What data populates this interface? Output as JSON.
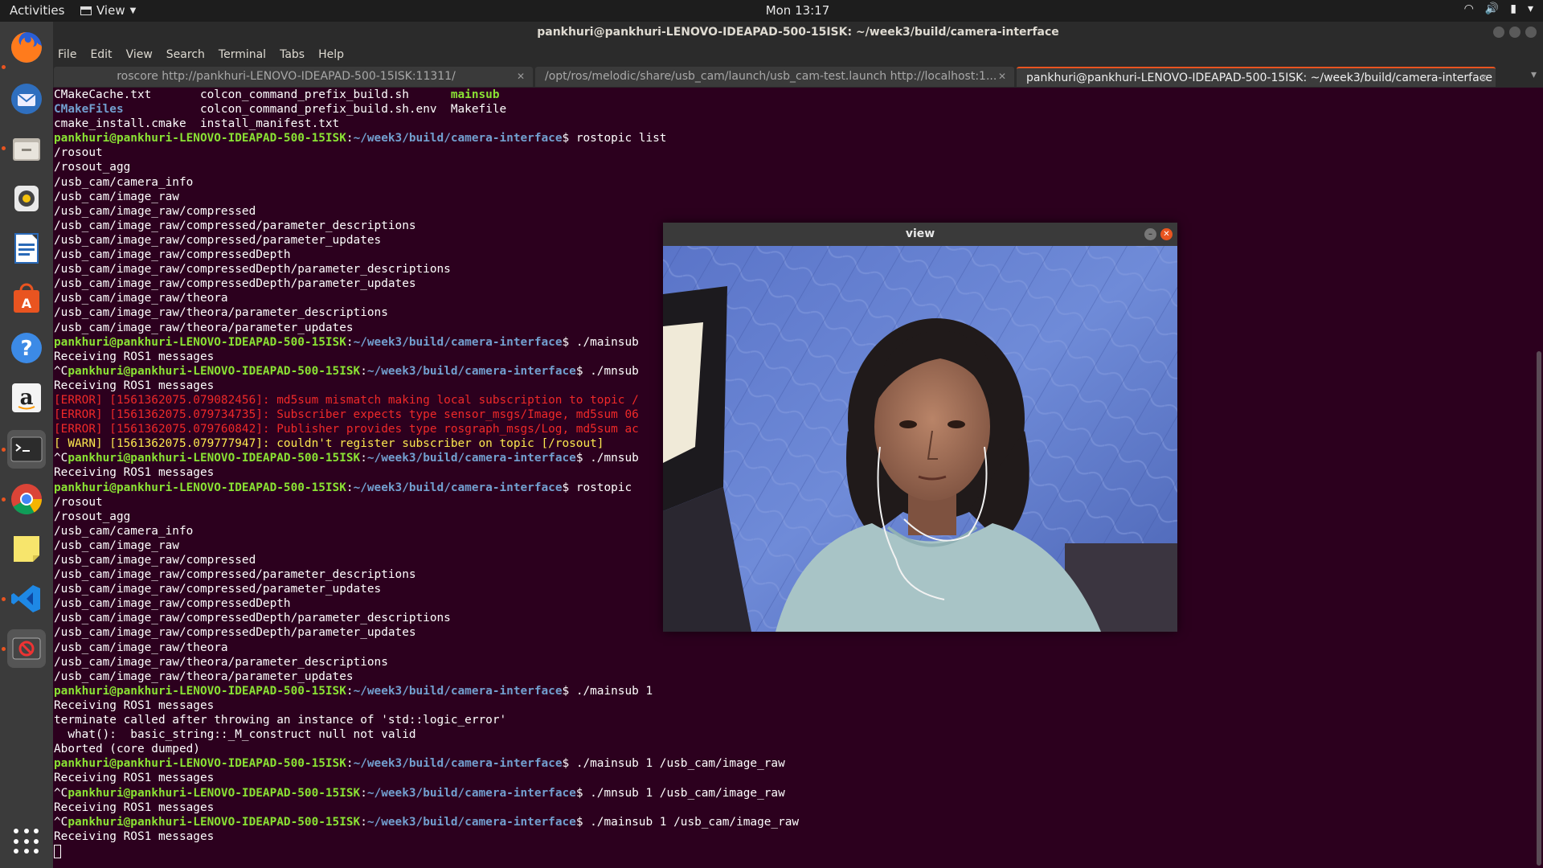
{
  "topbar": {
    "activities": "Activities",
    "view_menu": "View",
    "clock": "Mon 13:17"
  },
  "dock": {
    "items": [
      {
        "name": "firefox-icon",
        "active": true
      },
      {
        "name": "thunderbird-icon",
        "active": false
      },
      {
        "name": "files-icon",
        "active": true
      },
      {
        "name": "rhythmbox-icon",
        "active": false
      },
      {
        "name": "libreoffice-writer-icon",
        "active": false
      },
      {
        "name": "software-center-icon",
        "active": false
      },
      {
        "name": "help-icon",
        "active": false
      },
      {
        "name": "amazon-icon",
        "active": false
      },
      {
        "name": "terminal-icon",
        "active": true
      },
      {
        "name": "chrome-icon",
        "active": true
      },
      {
        "name": "sticky-notes-icon",
        "active": false
      },
      {
        "name": "vscode-icon",
        "active": true
      },
      {
        "name": "blocked-app-icon",
        "active": true
      }
    ],
    "show_apps": "show-applications-icon"
  },
  "terminal": {
    "title": "pankhuri@pankhuri-LENOVO-IDEAPAD-500-15ISK: ~/week3/build/camera-interface",
    "menu": [
      "File",
      "Edit",
      "View",
      "Search",
      "Terminal",
      "Tabs",
      "Help"
    ],
    "tabs": [
      {
        "label": "roscore http://pankhuri-LENOVO-IDEAPAD-500-15ISK:11311/",
        "active": false
      },
      {
        "label": "/opt/ros/melodic/share/usb_cam/launch/usb_cam-test.launch http://localhost:1...",
        "active": false
      },
      {
        "label": "pankhuri@pankhuri-LENOVO-IDEAPAD-500-15ISK: ~/week3/build/camera-interface",
        "active": true
      }
    ],
    "prompt_user": "pankhuri@pankhuri-LENOVO-IDEAPAD-500-15ISK",
    "prompt_path": "~/week3/build/camera-interface",
    "lines": [
      {
        "t": "ls",
        "parts": [
          [
            "CMakeCache.txt       ",
            ""
          ],
          [
            "colcon_command_prefix_build.sh      ",
            ""
          ],
          [
            "mainsub",
            "exec"
          ]
        ]
      },
      {
        "t": "ls",
        "parts": [
          [
            "CMakeFiles",
            "dir"
          ],
          [
            "           colcon_command_prefix_build.sh.env  Makefile",
            ""
          ]
        ]
      },
      {
        "t": "out",
        "text": "cmake_install.cmake  install_manifest.txt"
      },
      {
        "t": "prompt",
        "pre": "",
        "cmd": " rostopic list"
      },
      {
        "t": "out",
        "text": "/rosout"
      },
      {
        "t": "out",
        "text": "/rosout_agg"
      },
      {
        "t": "out",
        "text": "/usb_cam/camera_info"
      },
      {
        "t": "out",
        "text": "/usb_cam/image_raw"
      },
      {
        "t": "out",
        "text": "/usb_cam/image_raw/compressed"
      },
      {
        "t": "out",
        "text": "/usb_cam/image_raw/compressed/parameter_descriptions"
      },
      {
        "t": "out",
        "text": "/usb_cam/image_raw/compressed/parameter_updates"
      },
      {
        "t": "out",
        "text": "/usb_cam/image_raw/compressedDepth"
      },
      {
        "t": "out",
        "text": "/usb_cam/image_raw/compressedDepth/parameter_descriptions"
      },
      {
        "t": "out",
        "text": "/usb_cam/image_raw/compressedDepth/parameter_updates"
      },
      {
        "t": "out",
        "text": "/usb_cam/image_raw/theora"
      },
      {
        "t": "out",
        "text": "/usb_cam/image_raw/theora/parameter_descriptions"
      },
      {
        "t": "out",
        "text": "/usb_cam/image_raw/theora/parameter_updates"
      },
      {
        "t": "prompt",
        "pre": "",
        "cmd": " ./mainsub"
      },
      {
        "t": "out",
        "text": "Receiving ROS1 messages"
      },
      {
        "t": "prompt",
        "pre": "^C",
        "cmd": " ./mnsub"
      },
      {
        "t": "out",
        "text": "Receiving ROS1 messages"
      },
      {
        "t": "err",
        "text": "[ERROR] [1561362075.079082456]: md5sum mismatch making local subscription to topic /"
      },
      {
        "t": "err",
        "text": "[ERROR] [1561362075.079734735]: Subscriber expects type sensor_msgs/Image, md5sum 06"
      },
      {
        "t": "err",
        "text": "[ERROR] [1561362075.079760842]: Publisher provides type rosgraph_msgs/Log, md5sum ac"
      },
      {
        "t": "warn",
        "text": "[ WARN] [1561362075.079777947]: couldn't register subscriber on topic [/rosout]"
      },
      {
        "t": "prompt",
        "pre": "^C",
        "cmd": " ./mnsub"
      },
      {
        "t": "out",
        "text": "Receiving ROS1 messages"
      },
      {
        "t": "prompt",
        "pre": "",
        "cmd": " rostopic"
      },
      {
        "t": "out",
        "text": "/rosout"
      },
      {
        "t": "out",
        "text": "/rosout_agg"
      },
      {
        "t": "out",
        "text": "/usb_cam/camera_info"
      },
      {
        "t": "out",
        "text": "/usb_cam/image_raw"
      },
      {
        "t": "out",
        "text": "/usb_cam/image_raw/compressed"
      },
      {
        "t": "out",
        "text": "/usb_cam/image_raw/compressed/parameter_descriptions"
      },
      {
        "t": "out",
        "text": "/usb_cam/image_raw/compressed/parameter_updates"
      },
      {
        "t": "out",
        "text": "/usb_cam/image_raw/compressedDepth"
      },
      {
        "t": "out",
        "text": "/usb_cam/image_raw/compressedDepth/parameter_descriptions"
      },
      {
        "t": "out",
        "text": "/usb_cam/image_raw/compressedDepth/parameter_updates"
      },
      {
        "t": "out",
        "text": "/usb_cam/image_raw/theora"
      },
      {
        "t": "out",
        "text": "/usb_cam/image_raw/theora/parameter_descriptions"
      },
      {
        "t": "out",
        "text": "/usb_cam/image_raw/theora/parameter_updates"
      },
      {
        "t": "prompt",
        "pre": "",
        "cmd": " ./mainsub 1"
      },
      {
        "t": "out",
        "text": "Receiving ROS1 messages"
      },
      {
        "t": "out",
        "text": "terminate called after throwing an instance of 'std::logic_error'"
      },
      {
        "t": "out",
        "text": "  what():  basic_string::_M_construct null not valid"
      },
      {
        "t": "out",
        "text": "Aborted (core dumped)"
      },
      {
        "t": "prompt",
        "pre": "",
        "cmd": " ./mainsub 1 /usb_cam/image_raw"
      },
      {
        "t": "out",
        "text": "Receiving ROS1 messages"
      },
      {
        "t": "prompt",
        "pre": "^C",
        "cmd": " ./mnsub 1 /usb_cam/image_raw"
      },
      {
        "t": "out",
        "text": "Receiving ROS1 messages"
      },
      {
        "t": "prompt",
        "pre": "^C",
        "cmd": " ./mainsub 1 /usb_cam/image_raw"
      },
      {
        "t": "out",
        "text": "Receiving ROS1 messages"
      },
      {
        "t": "cursor"
      }
    ]
  },
  "view_window": {
    "title": "view",
    "image_desc": "webcam-frame-person"
  }
}
